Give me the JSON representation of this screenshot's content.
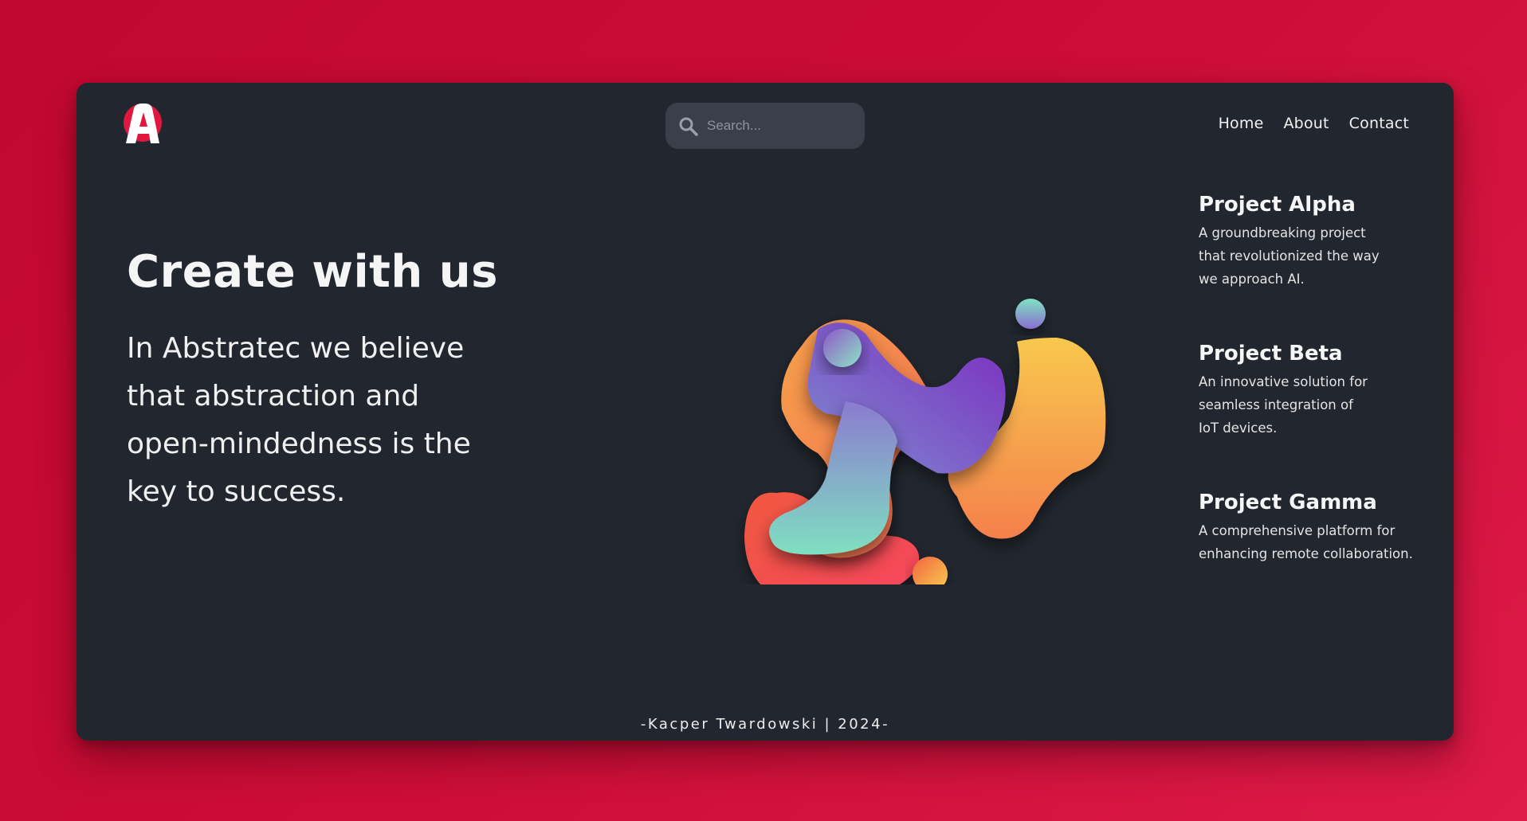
{
  "header": {
    "logo": {
      "letter": "A",
      "colors": {
        "primary": "#ffffff",
        "accent": "#e0173f"
      }
    },
    "search": {
      "placeholder": "Search...",
      "value": "",
      "icon": "search-icon"
    },
    "nav": [
      {
        "label": "Home"
      },
      {
        "label": "About"
      },
      {
        "label": "Contact"
      }
    ]
  },
  "hero": {
    "title": "Create with us",
    "lead": "In Abstratec we believe that abstraction and open-mindedness is the key to success."
  },
  "projects": [
    {
      "title": "Project Alpha",
      "description": "A groundbreaking project that revolutionized the way we approach AI."
    },
    {
      "title": "Project Beta",
      "description": "An innovative solution for seamless integration of IoT devices."
    },
    {
      "title": "Project Gamma",
      "description": "A comprehensive platform for enhancing remote collaboration."
    }
  ],
  "footer": {
    "text": "-Kacper Twardowski | 2024-"
  },
  "colors": {
    "background": "#cc0d36",
    "card": "#22272f",
    "search_bg": "#3a3f4a",
    "text": "#f5f5f5"
  }
}
